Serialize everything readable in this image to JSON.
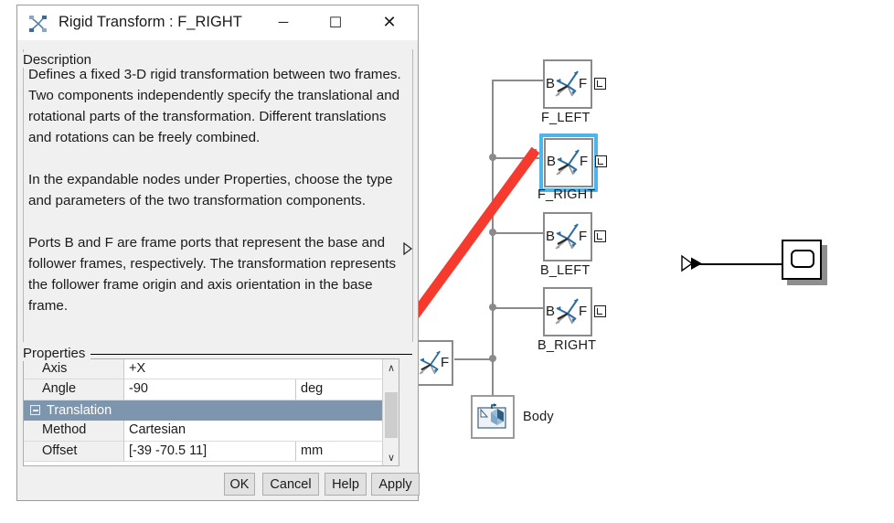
{
  "dialog": {
    "title": "Rigid Transform : F_RIGHT",
    "title_icon": "rigid-transform-icon",
    "window_buttons": [
      {
        "name": "minimize",
        "glyph": "─"
      },
      {
        "name": "maximize",
        "glyph": "☐"
      },
      {
        "name": "close",
        "glyph": "✕"
      }
    ],
    "description": {
      "group_label": "Description",
      "text": "Defines a fixed 3-D rigid transformation between two frames. Two components independently specify the translational and rotational parts of the transformation. Different translations and rotations can be freely combined.\n\nIn the expandable nodes under Properties, choose the type and parameters of the two transformation components.\n\nPorts B and F are frame ports that represent the base and follower frames, respectively. The transformation represents the follower frame origin and axis orientation in the base frame."
    },
    "properties": {
      "group_label": "Properties",
      "rows": [
        {
          "type": "field",
          "name": "Axis",
          "value": "+X",
          "unit": "",
          "has_value_caret": true,
          "has_unit_caret": false
        },
        {
          "type": "field",
          "name": "Angle",
          "value": "-90",
          "unit": "deg",
          "has_value_caret": true,
          "has_unit_caret": false
        },
        {
          "type": "group",
          "name": "Translation",
          "expanded": true,
          "selected": true
        },
        {
          "type": "field",
          "name": "Method",
          "value": "Cartesian",
          "unit": "",
          "has_value_caret": true,
          "has_unit_caret": false
        },
        {
          "type": "field",
          "name": "Offset",
          "value": "[-39 -70.5 11]",
          "unit": "mm",
          "has_value_caret": true,
          "has_unit_caret": true
        }
      ],
      "scrollbar": {
        "up_glyph": "∧",
        "down_glyph": "∨"
      }
    },
    "buttons": [
      {
        "name": "ok-button",
        "label": "OK"
      },
      {
        "name": "cancel-button",
        "label": "Cancel"
      },
      {
        "name": "help-button",
        "label": "Help"
      },
      {
        "name": "apply-button",
        "label": "Apply"
      }
    ],
    "panel_expander_glyph": "▷"
  },
  "canvas": {
    "blocks": [
      {
        "name": "F_LEFT",
        "label": "F_LEFT",
        "port_b": "B",
        "port_f": "F",
        "selected": false
      },
      {
        "name": "F_RIGHT",
        "label": "F_RIGHT",
        "port_b": "B",
        "port_f": "F",
        "selected": true
      },
      {
        "name": "B_LEFT",
        "label": "B_LEFT",
        "port_b": "B",
        "port_f": "F",
        "selected": false
      },
      {
        "name": "B_RIGHT",
        "label": "B_RIGHT",
        "port_b": "B",
        "port_f": "F",
        "selected": false
      },
      {
        "name": "transform-unnamed",
        "label": "",
        "port_b": "B",
        "port_f": "F",
        "selected": false
      }
    ],
    "body_block": {
      "label": "Body",
      "icon": "solid-body-icon"
    },
    "scope_block": {
      "label": "",
      "icon": "scope-icon"
    },
    "colors": {
      "selection": "#4cb5ec",
      "wire": "#8a8a8a",
      "annotation_arrow": "#f63a2e",
      "block_border": "#8a8a8a",
      "axes_blue": "#2b6ca3",
      "axes_gray": "#9a9a9a",
      "group_row": "#7e96ad"
    }
  }
}
